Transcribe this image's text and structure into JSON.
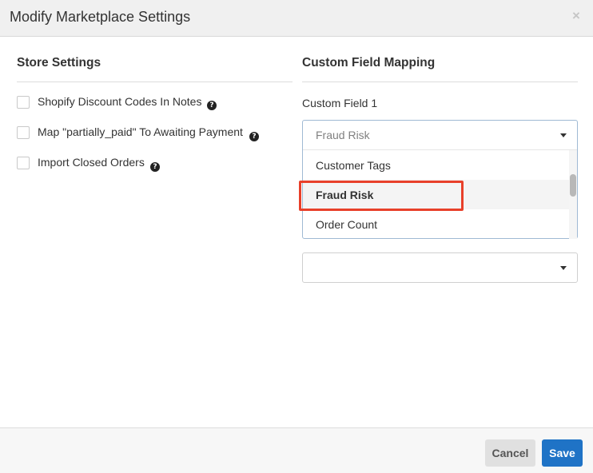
{
  "modal": {
    "title": "Modify Marketplace Settings",
    "close_glyph": "×"
  },
  "store_settings": {
    "title": "Store Settings",
    "options": [
      {
        "label": "Shopify Discount Codes In Notes",
        "checked": false
      },
      {
        "label": "Map \"partially_paid\" To Awaiting Payment",
        "checked": false
      },
      {
        "label": "Import Closed Orders",
        "checked": false
      }
    ],
    "help_glyph": "?"
  },
  "custom_field_mapping": {
    "title": "Custom Field Mapping",
    "field_label": "Custom Field 1",
    "select": {
      "current_value": "Fraud Risk",
      "options": [
        "Customer Tags",
        "Fraud Risk",
        "Order Count"
      ],
      "highlighted": "Fraud Risk"
    },
    "second_select": {
      "current_value": ""
    }
  },
  "footer": {
    "cancel_label": "Cancel",
    "save_label": "Save"
  },
  "colors": {
    "save_button": "#1f73c6",
    "highlight_border": "#e8402a",
    "header_bg": "#f0f0f0"
  }
}
